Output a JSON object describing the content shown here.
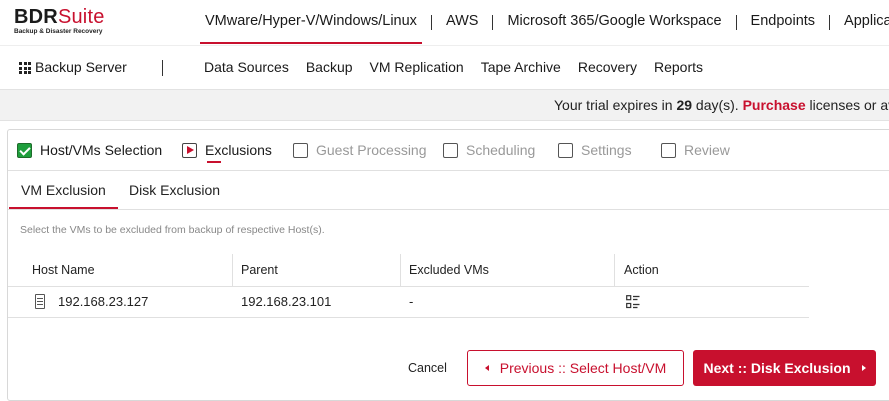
{
  "brand": {
    "name_dark": "BDR",
    "name_red": "Suite",
    "tagline": "Backup & Disaster Recovery",
    "accent_color": "#c8102e"
  },
  "top_nav": {
    "items": [
      {
        "label": "VMware/Hyper-V/Windows/Linux",
        "active": true
      },
      {
        "label": "AWS",
        "active": false
      },
      {
        "label": "Microsoft 365/Google Workspace",
        "active": false
      },
      {
        "label": "Endpoints",
        "active": false
      },
      {
        "label": "Applications",
        "active": false
      }
    ]
  },
  "sub_nav": {
    "app_menu_icon": "grid-icon",
    "app_label": "Backup Server",
    "items": [
      "Data Sources",
      "Backup",
      "VM Replication",
      "Tape Archive",
      "Recovery",
      "Reports"
    ]
  },
  "trial_banner": {
    "prefix": "Your trial expires in ",
    "days": "29",
    "middle": " day(s). ",
    "link": "Purchase",
    "suffix": " licenses or avail"
  },
  "wizard": {
    "steps": [
      {
        "label": "Host/VMs Selection",
        "state": "done"
      },
      {
        "label": "Exclusions",
        "state": "current"
      },
      {
        "label": "Guest Processing",
        "state": "pending"
      },
      {
        "label": "Scheduling",
        "state": "pending"
      },
      {
        "label": "Settings",
        "state": "pending"
      },
      {
        "label": "Review",
        "state": "pending"
      }
    ]
  },
  "tabs": [
    {
      "label": "VM Exclusion",
      "active": true
    },
    {
      "label": "Disk Exclusion",
      "active": false
    }
  ],
  "hint": "Select the VMs to be excluded from backup of respective Host(s).",
  "table": {
    "headers": [
      "Host Name",
      "Parent",
      "Excluded VMs",
      "Action"
    ],
    "rows": [
      {
        "host": "192.168.23.127",
        "parent": "192.168.23.101",
        "excluded": "-",
        "action_icon": "checklist-icon"
      }
    ]
  },
  "footer": {
    "cancel": "Cancel",
    "previous": "Previous :: Select Host/VM",
    "next": "Next :: Disk Exclusion"
  }
}
